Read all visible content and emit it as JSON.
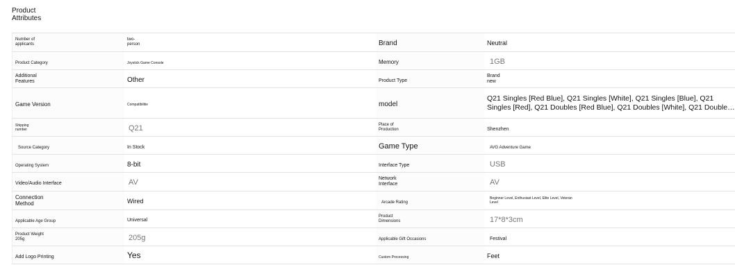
{
  "title": "Product\nAttributes",
  "rows": [
    {
      "l1": "Number of\napplicants",
      "v1": "two-\nperson",
      "l2": "Brand",
      "v2": "Neutral"
    },
    {
      "l1": "Product Category",
      "v1": "Joystick Game Console",
      "l2": "Memory",
      "v2": "1GB"
    },
    {
      "l1": "Additional\nFeatures",
      "v1": "Other",
      "l2": "Product Type",
      "v2": "Brand\nnew"
    },
    {
      "l1": "Game Version",
      "v1": "Compatibilitie",
      "l2": "model",
      "v2": "Q21 Singles [Red Blue], Q21 Singles [White], Q21 Singles [Blue], Q21 Singles [Red], Q21 Doubles [Red Blue], Q21 Doubles [White], Q21 Doubles [Blue], Q21 Doubles..."
    },
    {
      "l1": "Shipping\nnumber",
      "v1": "Q21",
      "l2": "Place of\nProduction",
      "v2": "Shenzhen"
    },
    {
      "l1": "Source Category",
      "v1": "In Stock",
      "l2": "Game Type",
      "v2": "AVG Adventure Game"
    },
    {
      "l1": "Operating System",
      "v1": "8-bit",
      "l2": "Interface Type",
      "v2": "USB"
    },
    {
      "l1": "Video/Audio Interface",
      "v1": "AV",
      "l2": "Network\nInterface",
      "v2": "AV"
    },
    {
      "l1": "Connection\nMethod",
      "v1": "Wired",
      "l2": "Arcade Rating",
      "v2": "Beginner Level, Enthusiast Level, Elite Level, Veteran\nLevel"
    },
    {
      "l1": "Applicable Age Group",
      "v1": "Universal",
      "l2": "Product\nDimensions",
      "v2": "17*8*3cm"
    },
    {
      "l1": "Product Weight\n205g",
      "v1": "205g",
      "l2": "Applicable Gift Occasions",
      "v2": "Festival"
    },
    {
      "l1": "Add Logo Printing",
      "v1": "Yes",
      "l2": "Custom Processing",
      "v2": "Feet"
    }
  ]
}
